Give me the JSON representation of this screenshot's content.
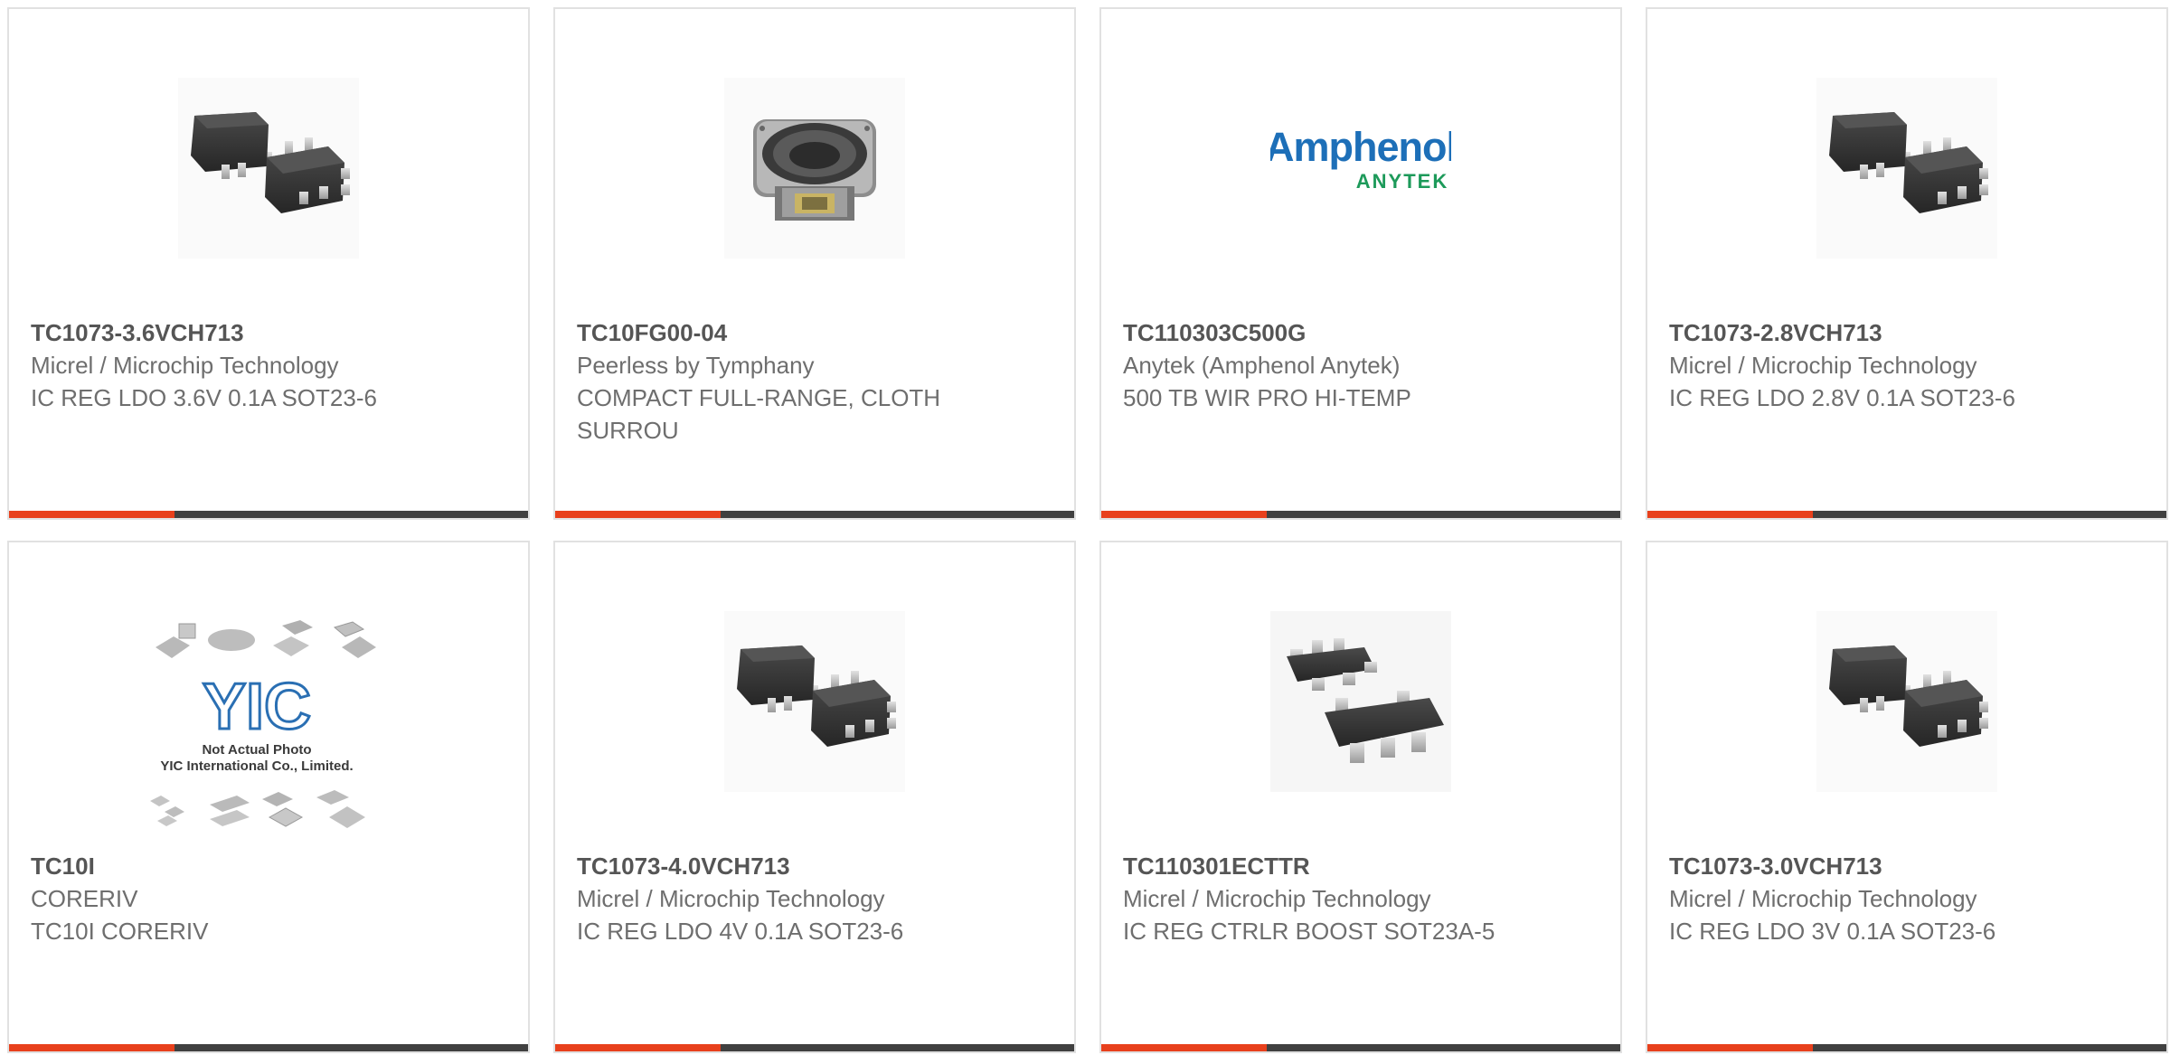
{
  "products": [
    {
      "part_number": "TC1073-3.6VCH713",
      "manufacturer": "Micrel / Microchip Technology",
      "description": "IC REG LDO 3.6V 0.1A SOT23-6",
      "image": "sot23-6-package-image"
    },
    {
      "part_number": "TC10FG00-04",
      "manufacturer": "Peerless by Tymphany",
      "description": "COMPACT FULL-RANGE, CLOTH SURROU",
      "image": "speaker-driver-image"
    },
    {
      "part_number": "TC110303C500G",
      "manufacturer": "Anytek (Amphenol Anytek)",
      "description": "500 TB WIR PRO HI-TEMP",
      "image": "amphenol-anytek-logo",
      "logo_line1": "Amphenol",
      "logo_line2": "ANYTEK"
    },
    {
      "part_number": "TC1073-2.8VCH713",
      "manufacturer": "Micrel / Microchip Technology",
      "description": "IC REG LDO 2.8V 0.1A SOT23-6",
      "image": "sot23-6-package-image"
    },
    {
      "part_number": "TC10I",
      "manufacturer": "CORERIV",
      "description": "TC10I CORERIV",
      "image": "not-actual-photo-placeholder",
      "placeholder_logo": "YIC",
      "placeholder_line1": "Not Actual Photo",
      "placeholder_line2": "YIC International Co., Limited."
    },
    {
      "part_number": "TC1073-4.0VCH713",
      "manufacturer": "Micrel / Microchip Technology",
      "description": "IC REG LDO 4V 0.1A SOT23-6",
      "image": "sot23-6-package-image"
    },
    {
      "part_number": "TC110301ECTTR",
      "manufacturer": "Micrel / Microchip Technology",
      "description": "IC REG CTRLR BOOST SOT23A-5",
      "image": "sot23-5-package-image"
    },
    {
      "part_number": "TC1073-3.0VCH713",
      "manufacturer": "Micrel / Microchip Technology",
      "description": "IC REG LDO 3V 0.1A SOT23-6",
      "image": "sot23-6-package-image"
    }
  ],
  "colors": {
    "accent": "#e8401c",
    "bar_dark": "#404040",
    "card_border": "#e1e1e1",
    "amphenol_blue": "#1d6fb8",
    "anytek_green": "#1d9a5a"
  }
}
